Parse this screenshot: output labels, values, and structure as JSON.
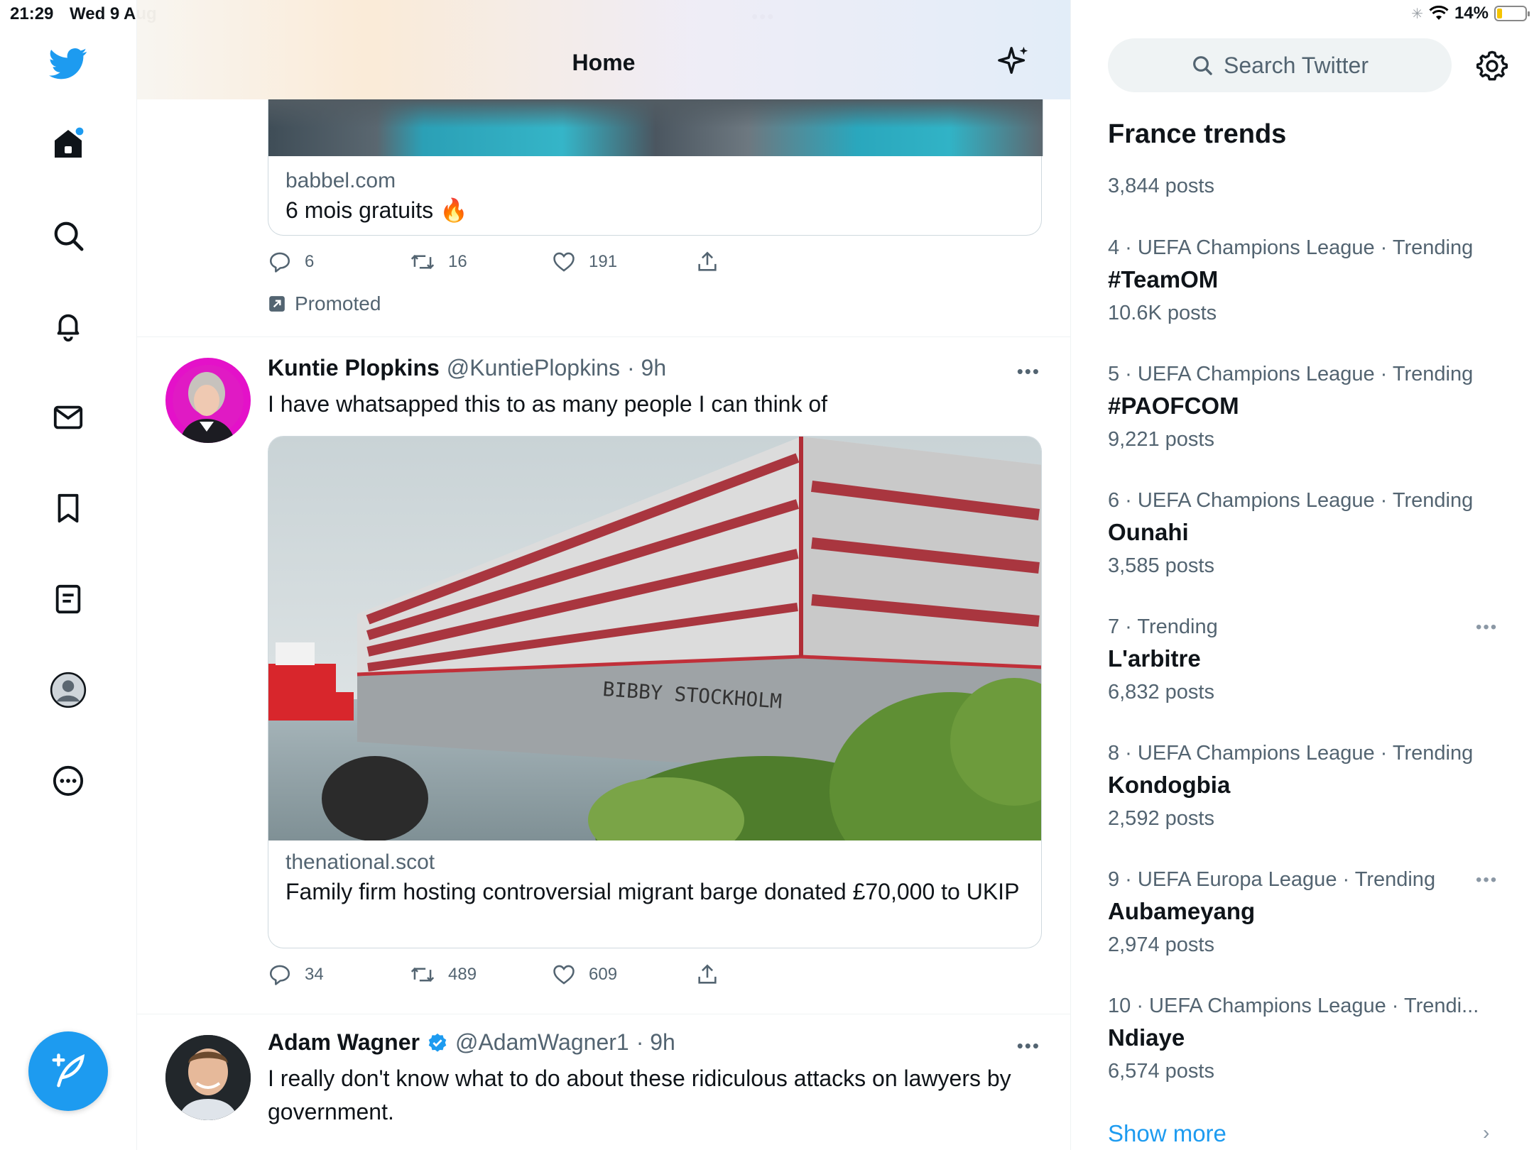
{
  "status_bar": {
    "time": "21:29",
    "date": "Wed 9 Aug",
    "battery": "14%"
  },
  "nav": {
    "items": [
      "Home",
      "Explore",
      "Notifications",
      "Messages",
      "Bookmarks",
      "Lists",
      "Profile",
      "More"
    ],
    "brand_color": "#1d9bf0"
  },
  "header": {
    "title": "Home"
  },
  "promo_tweet": {
    "card_domain": "babbel.com",
    "card_title": "6 mois gratuits 🔥",
    "replies": "6",
    "retweets": "16",
    "likes": "191",
    "promoted_label": "Promoted"
  },
  "tweets": [
    {
      "name": "Kuntie Plopkins",
      "handle": "@KuntiePlopkins",
      "time": "· 9h",
      "text": "I have whatsapped this to as many people I can think of",
      "card_domain": "thenational.scot",
      "card_title": "Family firm hosting controversial migrant barge donated £70,000 to UKIP",
      "media_label": "BIBBY STOCKHOLM",
      "replies": "34",
      "retweets": "489",
      "likes": "609"
    },
    {
      "name": "Adam Wagner",
      "handle": "@AdamWagner1",
      "time": "· 9h",
      "text": "I really don't know what to do about these ridiculous attacks on lawyers by government."
    }
  ],
  "search": {
    "placeholder": "Search Twitter"
  },
  "trends": {
    "title": "France trends",
    "first_posts": "3,844 posts",
    "items": [
      {
        "meta": "4 · UEFA Champions League · Trending",
        "topic": "#TeamOM",
        "posts": "10.6K posts"
      },
      {
        "meta": "5 · UEFA Champions League · Trending",
        "topic": "#PAOFCOM",
        "posts": "9,221 posts"
      },
      {
        "meta": "6 · UEFA Champions League · Trending",
        "topic": "Ounahi",
        "posts": "3,585 posts"
      },
      {
        "meta": "7 · Trending",
        "topic": "L'arbitre",
        "posts": "6,832 posts"
      },
      {
        "meta": "8 · UEFA Champions League · Trending",
        "topic": "Kondogbia",
        "posts": "2,592 posts"
      },
      {
        "meta": "9 · UEFA Europa League · Trending",
        "topic": "Aubameyang",
        "posts": "2,974 posts"
      },
      {
        "meta": "10 · UEFA Champions League · Trendi...",
        "topic": "Ndiaye",
        "posts": "6,574 posts"
      }
    ],
    "show_more": "Show more"
  }
}
